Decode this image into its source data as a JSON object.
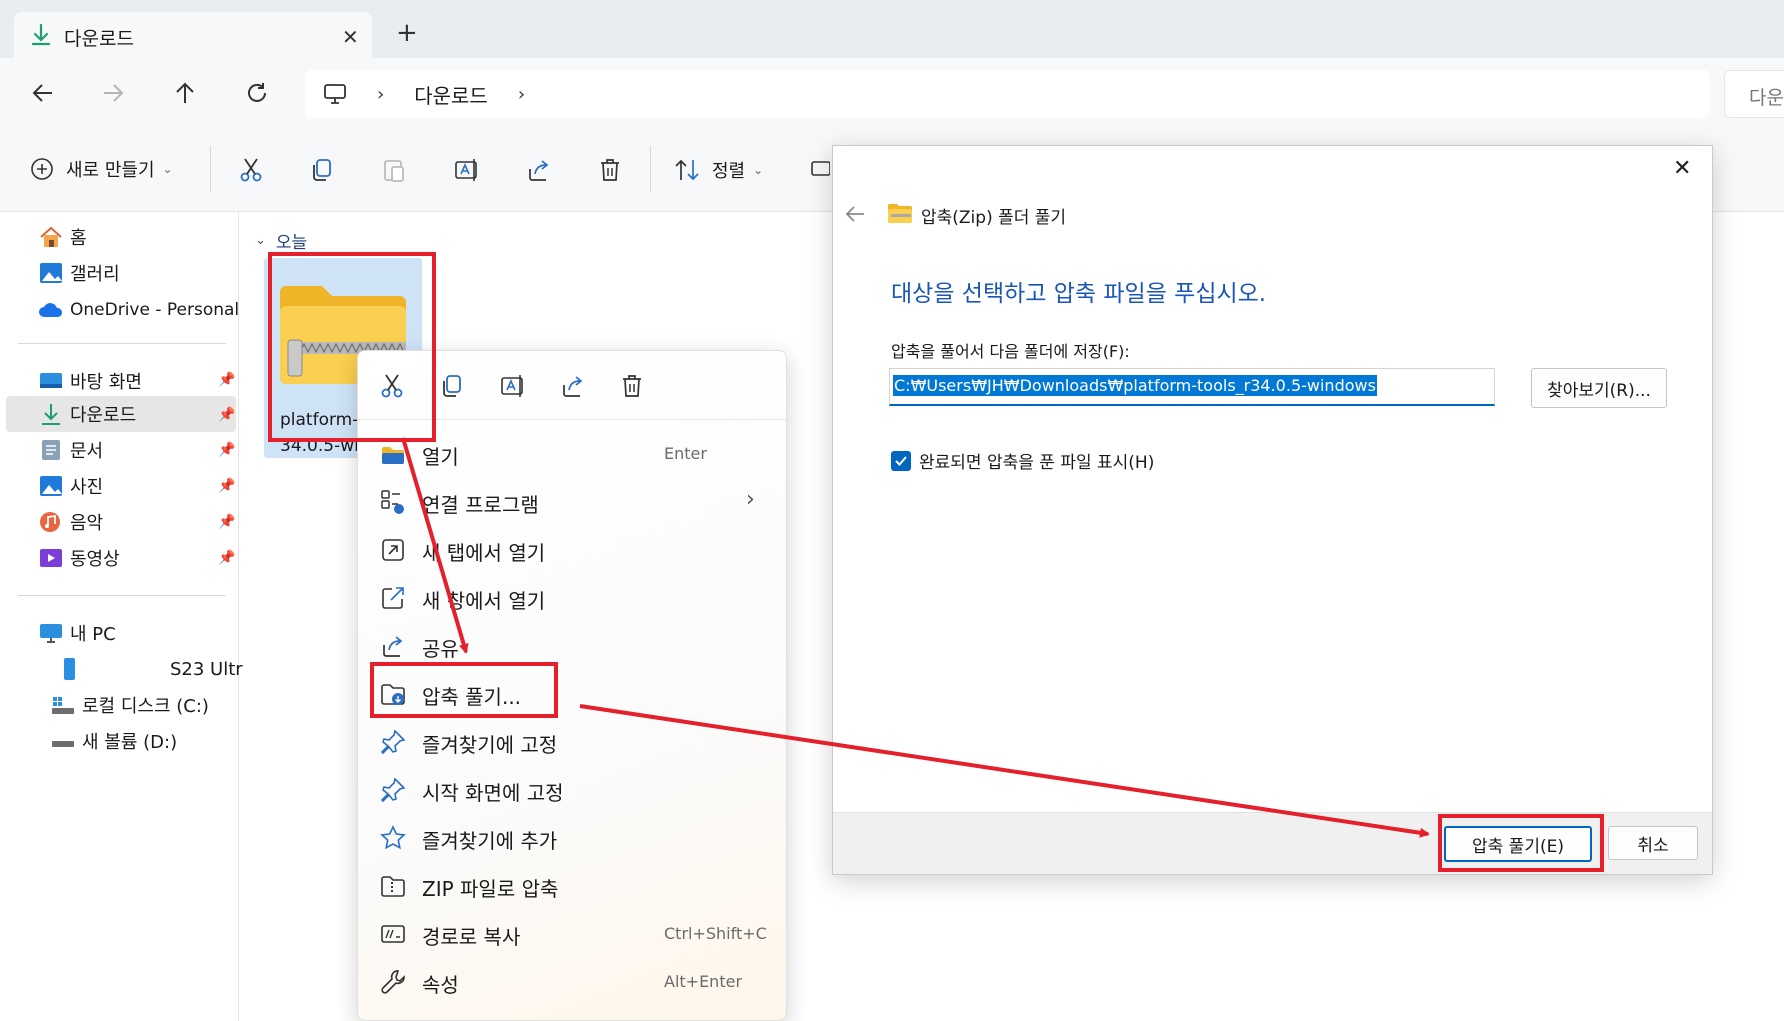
{
  "window": {
    "tab_title": "다운로드",
    "new_tab": "+",
    "close_tab": "✕"
  },
  "address": {
    "crumb": "다운로드",
    "search_placeholder": "다운"
  },
  "toolbar": {
    "new_label": "새로 만들기",
    "sort_label": "정렬"
  },
  "nav": {
    "home": "홈",
    "gallery": "갤러리",
    "onedrive": "OneDrive - Personal",
    "desktop": "바탕 화면",
    "downloads": "다운로드",
    "documents": "문서",
    "pictures": "사진",
    "music": "음악",
    "videos": "동영상",
    "this_pc": "내 PC",
    "phone": "S23 Ultr",
    "local_disk": "로컬 디스크 (C:)",
    "new_volume": "새 볼륨 (D:)"
  },
  "content": {
    "group_header": "오늘",
    "file_name_line1": "platform-",
    "file_name_line2": "34.0.5-wi"
  },
  "context_menu": {
    "items": [
      {
        "label": "열기",
        "shortcut": "Enter"
      },
      {
        "label": "연결 프로그램",
        "shortcut": ""
      },
      {
        "label": "새 탭에서 열기",
        "shortcut": ""
      },
      {
        "label": "새 창에서 열기",
        "shortcut": ""
      },
      {
        "label": "공유",
        "shortcut": ""
      },
      {
        "label": "압축 풀기...",
        "shortcut": ""
      },
      {
        "label": "즐겨찾기에 고정",
        "shortcut": ""
      },
      {
        "label": "시작 화면에 고정",
        "shortcut": ""
      },
      {
        "label": "즐겨찾기에 추가",
        "shortcut": ""
      },
      {
        "label": "ZIP 파일로 압축",
        "shortcut": ""
      },
      {
        "label": "경로로 복사",
        "shortcut": "Ctrl+Shift+C"
      },
      {
        "label": "속성",
        "shortcut": "Alt+Enter"
      }
    ]
  },
  "dialog": {
    "title": "압축(Zip) 폴더 풀기",
    "heading": "대상을 선택하고 압축 파일을 푸십시오.",
    "path_label": "압축을 풀어서 다음 폴더에 저장(F):",
    "path_value": "C:₩Users₩JH₩Downloads₩platform-tools_r34.0.5-windows",
    "browse_button": "찾아보기(R)...",
    "show_files_checkbox": "완료되면 압축을 푼 파일 표시(H)",
    "show_files_checked": true,
    "extract_button": "압축 풀기(E)",
    "cancel_button": "취소",
    "close": "✕"
  },
  "colors": {
    "accent": "#0067c0",
    "highlight_box": "#e3202b",
    "heading_blue": "#1a55b8"
  }
}
